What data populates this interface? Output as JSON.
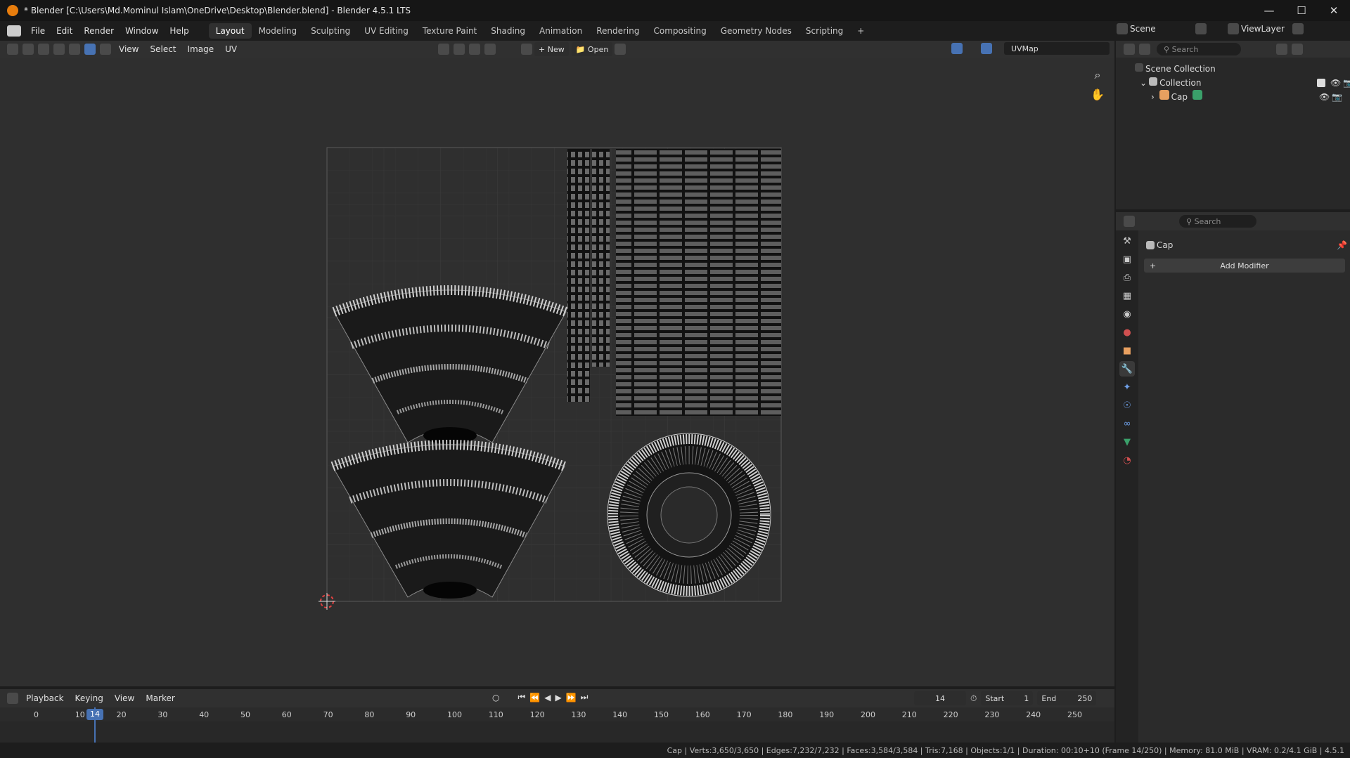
{
  "window": {
    "title": "* Blender [C:\\Users\\Md.Mominul Islam\\OneDrive\\Desktop\\Blender.blend] - Blender 4.5.1 LTS"
  },
  "menus": [
    "File",
    "Edit",
    "Render",
    "Window",
    "Help"
  ],
  "workspaces": [
    "Layout",
    "Modeling",
    "Sculpting",
    "UV Editing",
    "Texture Paint",
    "Shading",
    "Animation",
    "Rendering",
    "Compositing",
    "Geometry Nodes",
    "Scripting"
  ],
  "active_workspace": "Layout",
  "topright": {
    "scene": "Scene",
    "view_layer": "ViewLayer"
  },
  "uv_header": {
    "menus": [
      "View",
      "Select",
      "Image",
      "UV"
    ],
    "new_label": "New",
    "open_label": "Open",
    "uvmap": "UVMap"
  },
  "outliner": {
    "search_placeholder": "Search",
    "scene_collection": "Scene Collection",
    "collection": "Collection",
    "object": "Cap"
  },
  "properties": {
    "search_placeholder": "Search",
    "object_name": "Cap",
    "add_modifier": "Add Modifier"
  },
  "timeline": {
    "menus": [
      "Playback",
      "Keying",
      "View",
      "Marker"
    ],
    "current_frame": "14",
    "start_label": "Start",
    "start": "1",
    "end_label": "End",
    "end": "250",
    "ruler": [
      "0",
      "10",
      "14",
      "20",
      "30",
      "40",
      "50",
      "60",
      "70",
      "80",
      "90",
      "100",
      "110",
      "120",
      "130",
      "140",
      "150",
      "160",
      "170",
      "180",
      "190",
      "200",
      "210",
      "220",
      "230",
      "240",
      "250"
    ]
  },
  "status_bar": "Cap | Verts:3,650/3,650 | Edges:7,232/7,232 | Faces:3,584/3,584 | Tris:7,168 | Objects:1/1 | Duration: 00:10+10 (Frame 14/250) | Memory: 81.0 MiB | VRAM: 0.2/4.1 GiB | 4.5.1",
  "colors": {
    "accent": "#4772b3",
    "bg": "#2f2f2f",
    "uv_bounds": "#5a5a5a"
  }
}
